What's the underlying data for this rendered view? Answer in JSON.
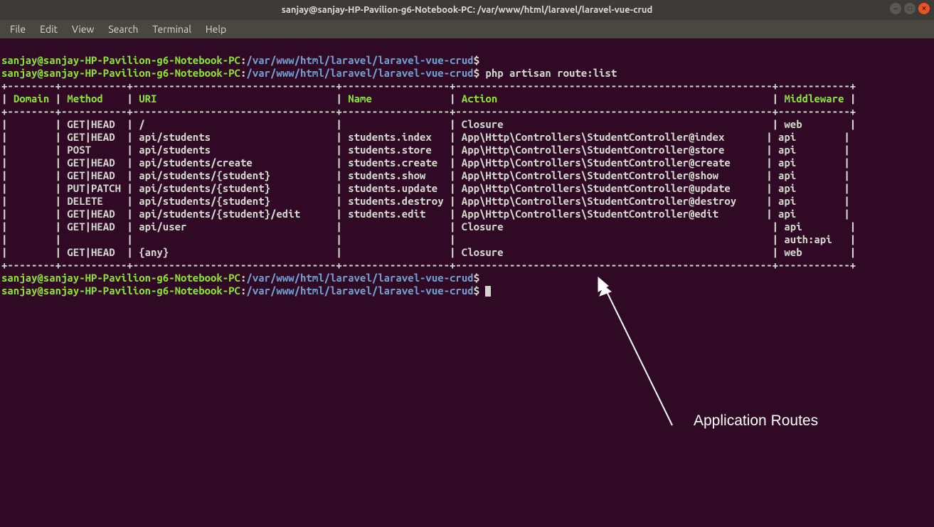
{
  "window": {
    "title": "sanjay@sanjay-HP-Pavilion-g6-Notebook-PC: /var/www/html/laravel/laravel-vue-crud"
  },
  "menu": {
    "file": "File",
    "edit": "Edit",
    "view": "View",
    "search": "Search",
    "terminal": "Terminal",
    "help": "Help"
  },
  "prompt": {
    "user": "sanjay@sanjay-HP-Pavilion-g6-Notebook-PC",
    "colon": ":",
    "path": "/var/www/html/laravel/laravel-vue-crud",
    "dollar": "$"
  },
  "commands": {
    "empty": "",
    "route_list": " php artisan route:list"
  },
  "table": {
    "border_top": "+--------+-----------+----------------------------------+------------------+-----------------------------------------------------+------------+",
    "header_domain": "Domain",
    "header_method": "Method",
    "header_uri": "URI",
    "header_name": "Name",
    "header_action": "Action",
    "header_middleware": "Middleware",
    "border_mid": "+--------+-----------+----------------------------------+------------------+-----------------------------------------------------+------------+",
    "rows": {
      "r0": "|        | GET|HEAD  | /                                |                  | Closure                                             | web        |",
      "r1": "|        | GET|HEAD  | api/students                     | students.index   | App\\Http\\Controllers\\StudentController@index       | api        |",
      "r2": "|        | POST      | api/students                     | students.store   | App\\Http\\Controllers\\StudentController@store       | api        |",
      "r3": "|        | GET|HEAD  | api/students/create              | students.create  | App\\Http\\Controllers\\StudentController@create      | api        |",
      "r4": "|        | GET|HEAD  | api/students/{student}           | students.show    | App\\Http\\Controllers\\StudentController@show        | api        |",
      "r5": "|        | PUT|PATCH | api/students/{student}           | students.update  | App\\Http\\Controllers\\StudentController@update      | api        |",
      "r6": "|        | DELETE    | api/students/{student}           | students.destroy | App\\Http\\Controllers\\StudentController@destroy     | api        |",
      "r7": "|        | GET|HEAD  | api/students/{student}/edit      | students.edit    | App\\Http\\Controllers\\StudentController@edit        | api        |",
      "r8": "|        | GET|HEAD  | api/user                         |                  | Closure                                             | api        |",
      "r9": "|        |           |                                  |                  |                                                     | auth:api   |",
      "r10": "|        | GET|HEAD  | {any}                            |                  | Closure                                             | web        |"
    },
    "border_bot": "+--------+-----------+----------------------------------+------------------+-----------------------------------------------------+------------+"
  },
  "annotation": {
    "label": "Application Routes"
  }
}
